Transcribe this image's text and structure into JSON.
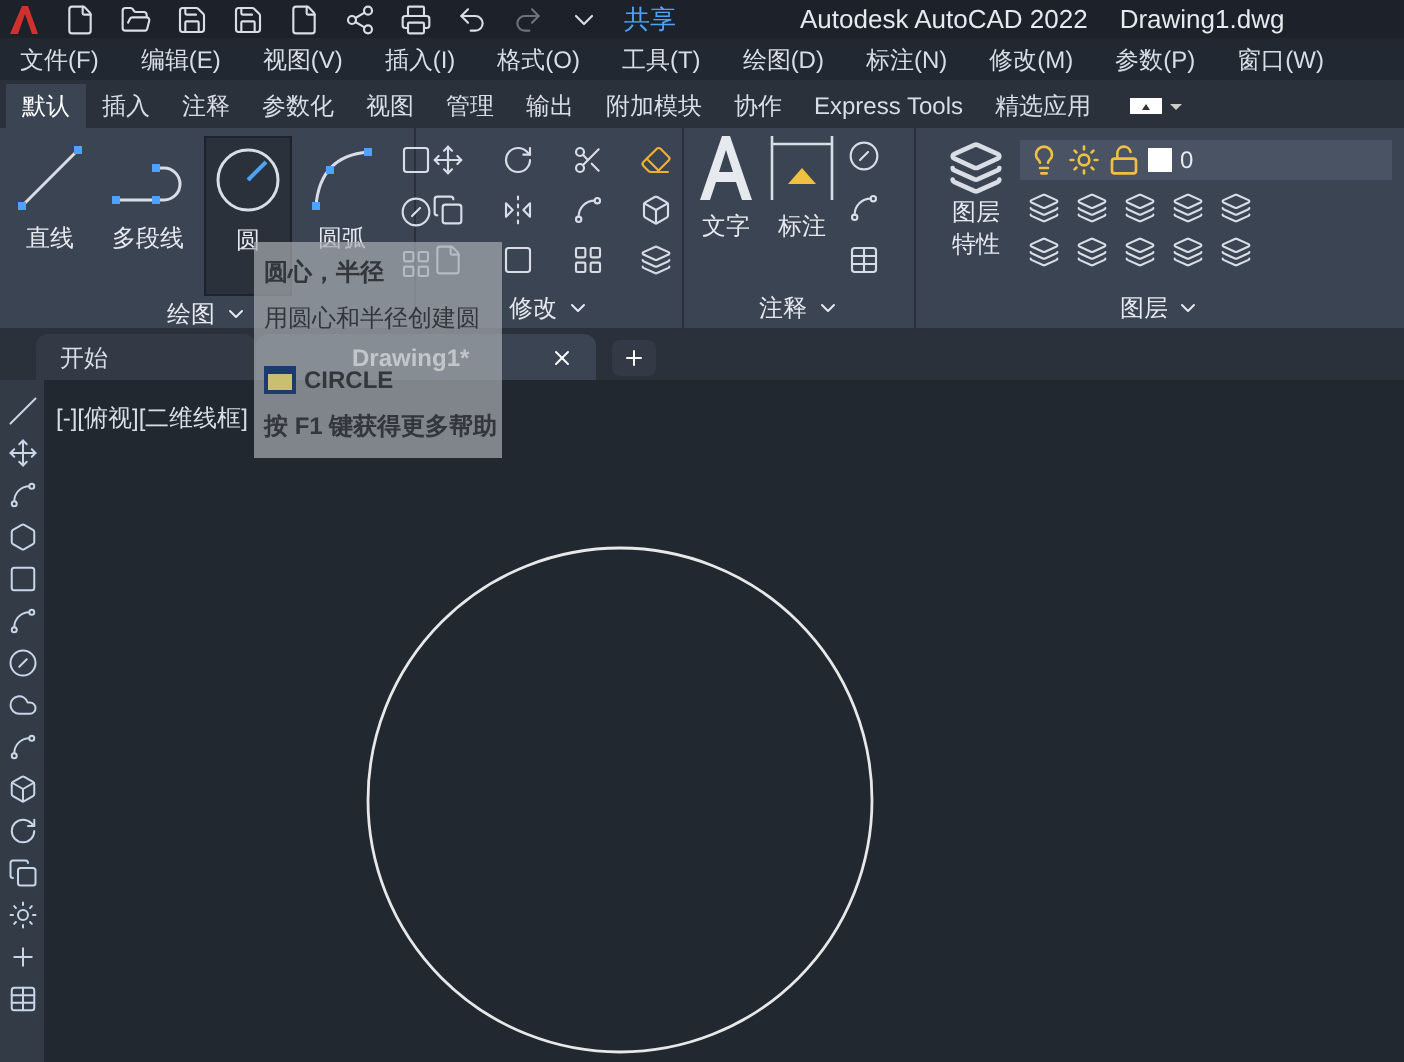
{
  "title_bar": {
    "share": "共享",
    "app_title": "Autodesk AutoCAD 2022",
    "file_name": "Drawing1.dwg"
  },
  "menu": [
    "文件(F)",
    "编辑(E)",
    "视图(V)",
    "插入(I)",
    "格式(O)",
    "工具(T)",
    "绘图(D)",
    "标注(N)",
    "修改(M)",
    "参数(P)",
    "窗口(W)"
  ],
  "ribbon_tabs": [
    {
      "label": "默认",
      "selected": true
    },
    {
      "label": "插入",
      "selected": false
    },
    {
      "label": "注释",
      "selected": false
    },
    {
      "label": "参数化",
      "selected": false
    },
    {
      "label": "视图",
      "selected": false
    },
    {
      "label": "管理",
      "selected": false
    },
    {
      "label": "输出",
      "selected": false
    },
    {
      "label": "附加模块",
      "selected": false
    },
    {
      "label": "协作",
      "selected": false
    },
    {
      "label": "Express Tools",
      "selected": false
    },
    {
      "label": "精选应用",
      "selected": false
    }
  ],
  "draw_panel": {
    "title": "绘图",
    "tools": [
      {
        "kind": "line",
        "label": "直线",
        "selected": false
      },
      {
        "kind": "polyline",
        "label": "多段线",
        "selected": false
      },
      {
        "kind": "circle",
        "label": "圆",
        "selected": true
      },
      {
        "kind": "arc",
        "label": "圆弧",
        "selected": false
      }
    ]
  },
  "modify_panel": {
    "title": "修改"
  },
  "annotation_panel": {
    "title": "注释",
    "tools": [
      {
        "kind": "text",
        "label": "文字"
      },
      {
        "kind": "dimension",
        "label": "标注"
      }
    ]
  },
  "layers_panel": {
    "title": "图层",
    "properties_label": "图层特性",
    "current_layer": "0"
  },
  "file_tabs": [
    {
      "label": "开始",
      "selected": false,
      "closable": false
    },
    {
      "label": "Drawing1*",
      "selected": true,
      "closable": true
    }
  ],
  "viewport_label": "[-][俯视][二维线框]",
  "tooltip": {
    "title": "圆心，半径",
    "description": "用圆心和半径创建圆",
    "command": "CIRCLE",
    "help": "按 F1 键获得更多帮助"
  }
}
